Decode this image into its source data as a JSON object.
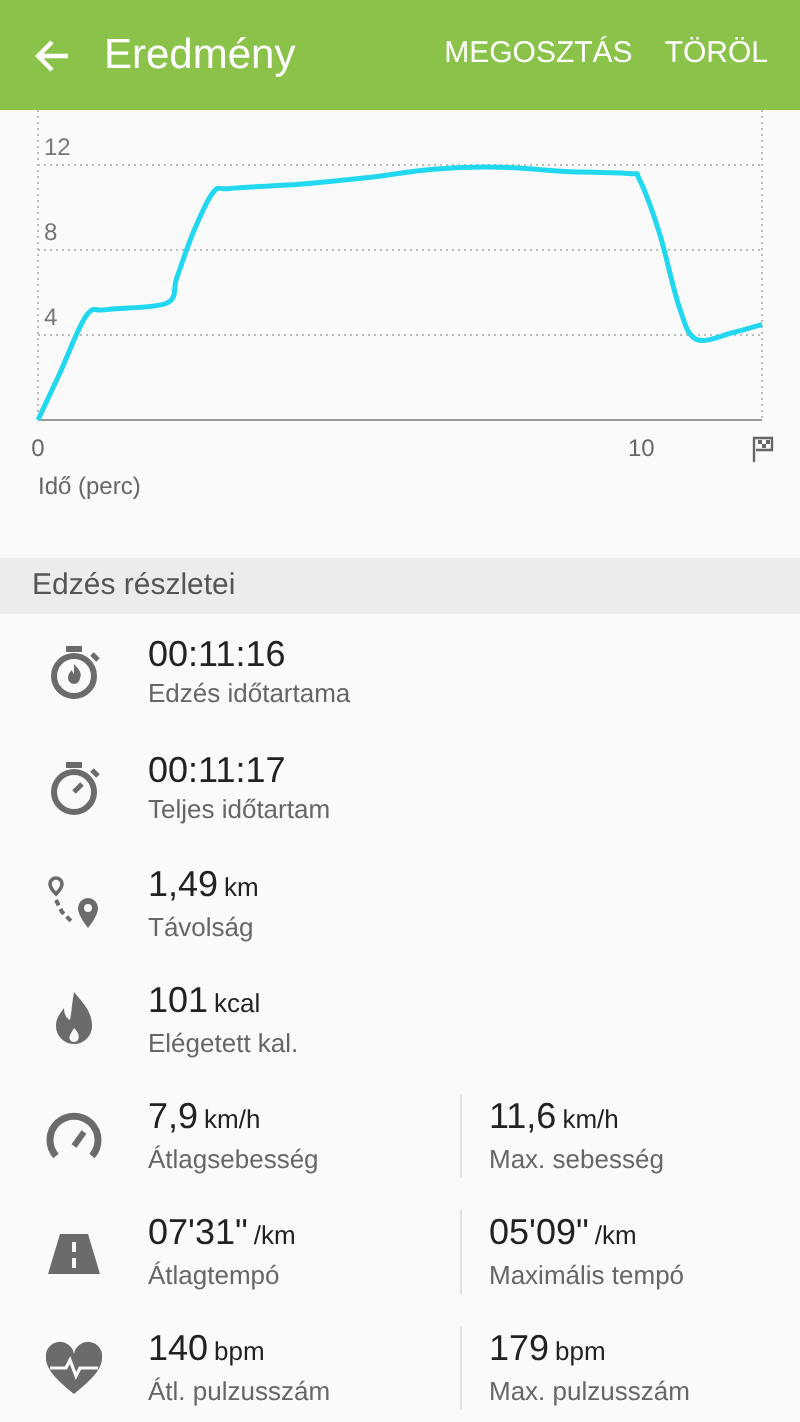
{
  "app_bar": {
    "title": "Eredmény",
    "actions": [
      "MEGOSZTÁS",
      "TÖRÖL"
    ]
  },
  "chart": {
    "chart_data": {
      "type": "line",
      "xlabel": "Idő (perc)",
      "xlim": [
        0,
        12
      ],
      "ylim": [
        0,
        14.4
      ],
      "xticks": [
        0,
        10
      ],
      "yticks": [
        4,
        8,
        12
      ],
      "grid": true,
      "x": [
        0,
        0.36,
        0.8,
        1.14,
        2.13,
        2.3,
        2.57,
        2.9,
        3.18,
        4.34,
        5.44,
        6.55,
        7.65,
        8.75,
        9.8,
        9.97,
        10.3,
        10.63,
        10.91,
        11.51,
        12
      ],
      "series": [
        {
          "color": "#22d8f0",
          "values": [
            0,
            2.2,
            4.9,
            5.2,
            5.5,
            6.7,
            8.8,
            10.7,
            10.9,
            11.1,
            11.4,
            11.8,
            11.9,
            11.7,
            11.6,
            11.3,
            8.8,
            5.3,
            3.8,
            4.1,
            4.5
          ]
        }
      ]
    }
  },
  "section_title": "Edzés részletei",
  "stats": [
    {
      "kind": "stopwatch-flame",
      "cells": [
        {
          "value": "00:11:16",
          "label": "Edzés időtartama"
        }
      ]
    },
    {
      "kind": "stopwatch",
      "cells": [
        {
          "value": "00:11:17",
          "label": "Teljes időtartam"
        }
      ]
    },
    {
      "kind": "route",
      "cells": [
        {
          "value": "1,49",
          "unit": "km",
          "label": "Távolság"
        }
      ]
    },
    {
      "kind": "flame",
      "cells": [
        {
          "value": "101",
          "unit": "kcal",
          "label": "Elégetett kal."
        }
      ]
    },
    {
      "kind": "speedometer",
      "cells": [
        {
          "value": "7,9",
          "unit": "km/h",
          "label": "Átlagsebesség"
        },
        {
          "value": "11,6",
          "unit": "km/h",
          "label": "Max. sebesség"
        }
      ]
    },
    {
      "kind": "road",
      "cells": [
        {
          "value": "07'31\"",
          "unit": "/km",
          "label": "Átlagtempó"
        },
        {
          "value": "05'09\"",
          "unit": "/km",
          "label": "Maximális tempó"
        }
      ]
    },
    {
      "kind": "heart",
      "cells": [
        {
          "value": "140",
          "unit": "bpm",
          "label": "Átl. pulzusszám"
        },
        {
          "value": "179",
          "unit": "bpm",
          "label": "Max. pulzusszám"
        }
      ]
    }
  ]
}
